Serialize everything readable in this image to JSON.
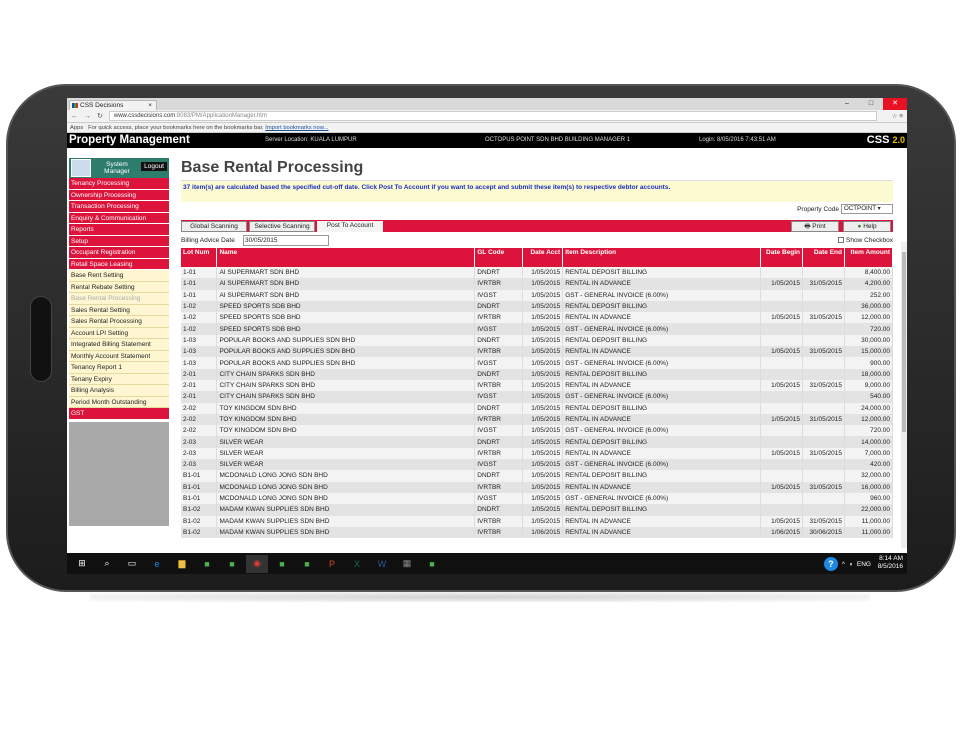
{
  "browser": {
    "tab_title": "CSS Decisions",
    "url_host": "www.cssdecisions.com",
    "url_path": ":8083/PM/ApplicationManager.htm",
    "bookmarks_apps": "Apps",
    "bookmarks_text": "For quick access, place your bookmarks here on the bookmarks bar.",
    "bookmarks_link": "Import bookmarks now..."
  },
  "header": {
    "brand": "Property Management",
    "server": "Server Location: KUALA LUMPUR",
    "company": "OCTOPUS POINT SDN BHD  BUILDING MANAGER 1",
    "login": "Login: 8/05/2016 7:43:51 AM",
    "product": "CSS",
    "version": "2.0"
  },
  "sidebar": {
    "user_role": "System Manager",
    "logout": "Logout",
    "main_items": [
      "Tenancy Processing",
      "Ownership Processing",
      "Transaction Processing",
      "Enquiry & Communication",
      "Reports",
      "Setup",
      "Occupant Registration",
      "Retail Space Leasing"
    ],
    "sub_items": [
      "Base Rent Setting",
      "Rental Rebate Setting",
      "Base Rental Processing",
      "Sales Rental Setting",
      "Sales Rental Processing",
      "Account LPI Setting",
      "Integrated Billing Statement",
      "Monthly Account Statement",
      "Tenancy Report 1",
      "Tenany Expiry",
      "Billing Analysis",
      "Period Month Outstanding"
    ],
    "last_item": "GST"
  },
  "page": {
    "title": "Base Rental Processing",
    "message": "37 item(s) are calculated based the specified cut-off date. Click Post To Account if you want to accept and submit these item(s) to respective debtor accounts.",
    "property_code_label": "Property Code",
    "property_code_value": "OCTPOINT",
    "buttons": {
      "global": "Global Scanning",
      "selective": "Selective Scanning",
      "post": "Post To Account",
      "print": "Print",
      "help": "Help"
    },
    "billing_label": "Billing Advice Date",
    "billing_value": "30/05/2015",
    "show_checkbox": "Show Checkbox"
  },
  "table": {
    "columns": [
      "Lot Num",
      "Name",
      "GL Code",
      "Date Acct",
      "Item Description",
      "Date Begin",
      "Date End",
      "Item Amount"
    ],
    "rows": [
      [
        "1-01",
        "AI SUPERMART SDN BHD",
        "DNDRT",
        "1/05/2015",
        "RENTAL DEPOSIT BILLING",
        "",
        "",
        "8,400.00"
      ],
      [
        "1-01",
        "AI SUPERMART SDN BHD",
        "IVRTBR",
        "1/05/2015",
        "RENTAL IN ADVANCE",
        "1/05/2015",
        "31/05/2015",
        "4,200.00"
      ],
      [
        "1-01",
        "AI SUPERMART SDN BHD",
        "IVGST",
        "1/05/2015",
        "GST - GENERAL INVOICE (6.00%)",
        "",
        "",
        "252.00"
      ],
      [
        "1-02",
        "SPEED SPORTS SDB BHD",
        "DNDRT",
        "1/05/2015",
        "RENTAL DEPOSIT BILLING",
        "",
        "",
        "36,000.00"
      ],
      [
        "1-02",
        "SPEED SPORTS SDB BHD",
        "IVRTBR",
        "1/05/2015",
        "RENTAL IN ADVANCE",
        "1/05/2015",
        "31/05/2015",
        "12,000.00"
      ],
      [
        "1-02",
        "SPEED SPORTS SDB BHD",
        "IVGST",
        "1/05/2015",
        "GST - GENERAL INVOICE (6.00%)",
        "",
        "",
        "720.00"
      ],
      [
        "1-03",
        "POPULAR BOOKS AND SUPPLIES SDN BHD",
        "DNDRT",
        "1/05/2015",
        "RENTAL DEPOSIT BILLING",
        "",
        "",
        "30,000.00"
      ],
      [
        "1-03",
        "POPULAR BOOKS AND SUPPLIES SDN BHD",
        "IVRTBR",
        "1/05/2015",
        "RENTAL IN ADVANCE",
        "1/05/2015",
        "31/05/2015",
        "15,000.00"
      ],
      [
        "1-03",
        "POPULAR BOOKS AND SUPPLIES SDN BHD",
        "IVGST",
        "1/05/2015",
        "GST - GENERAL INVOICE (6.00%)",
        "",
        "",
        "900.00"
      ],
      [
        "2-01",
        "CITY CHAIN SPARKS SDN BHD",
        "DNDRT",
        "1/05/2015",
        "RENTAL DEPOSIT BILLING",
        "",
        "",
        "18,000.00"
      ],
      [
        "2-01",
        "CITY CHAIN SPARKS SDN BHD",
        "IVRTBR",
        "1/05/2015",
        "RENTAL IN ADVANCE",
        "1/05/2015",
        "31/05/2015",
        "9,000.00"
      ],
      [
        "2-01",
        "CITY CHAIN SPARKS SDN BHD",
        "IVGST",
        "1/05/2015",
        "GST - GENERAL INVOICE (6.00%)",
        "",
        "",
        "540.00"
      ],
      [
        "2-02",
        "TOY KINGDOM SDN BHD",
        "DNDRT",
        "1/05/2015",
        "RENTAL DEPOSIT BILLING",
        "",
        "",
        "24,000.00"
      ],
      [
        "2-02",
        "TOY KINGDOM SDN BHD",
        "IVRTBR",
        "1/05/2015",
        "RENTAL IN ADVANCE",
        "1/05/2015",
        "31/05/2015",
        "12,000.00"
      ],
      [
        "2-02",
        "TOY KINGDOM SDN BHD",
        "IVGST",
        "1/05/2015",
        "GST - GENERAL INVOICE (6.00%)",
        "",
        "",
        "720.00"
      ],
      [
        "2-03",
        "SILVER WEAR",
        "DNDRT",
        "1/05/2015",
        "RENTAL DEPOSIT BILLING",
        "",
        "",
        "14,000.00"
      ],
      [
        "2-03",
        "SILVER WEAR",
        "IVRTBR",
        "1/05/2015",
        "RENTAL IN ADVANCE",
        "1/05/2015",
        "31/05/2015",
        "7,000.00"
      ],
      [
        "2-03",
        "SILVER WEAR",
        "IVGST",
        "1/05/2015",
        "GST - GENERAL INVOICE (6.00%)",
        "",
        "",
        "420.00"
      ],
      [
        "B1-01",
        "MCDONALD LONG JONG SDN BHD",
        "DNDRT",
        "1/05/2015",
        "RENTAL DEPOSIT BILLING",
        "",
        "",
        "32,000.00"
      ],
      [
        "B1-01",
        "MCDONALD LONG JONG SDN BHD",
        "IVRTBR",
        "1/05/2015",
        "RENTAL IN ADVANCE",
        "1/05/2015",
        "31/05/2015",
        "16,000.00"
      ],
      [
        "B1-01",
        "MCDONALD LONG JONG SDN BHD",
        "IVGST",
        "1/05/2015",
        "GST - GENERAL INVOICE (6.00%)",
        "",
        "",
        "960.00"
      ],
      [
        "B1-02",
        "MADAM KWAN SUPPLIES SDN BHD",
        "DNDRT",
        "1/05/2015",
        "RENTAL DEPOSIT BILLING",
        "",
        "",
        "22,000.00"
      ],
      [
        "B1-02",
        "MADAM KWAN SUPPLIES SDN BHD",
        "IVRTBR",
        "1/05/2015",
        "RENTAL IN ADVANCE",
        "1/05/2015",
        "31/05/2015",
        "11,000.00"
      ],
      [
        "B1-02",
        "MADAM KWAN SUPPLIES SDN BHD",
        "IVRTBR",
        "1/06/2015",
        "RENTAL IN ADVANCE",
        "1/06/2015",
        "30/06/2015",
        "11,000.00"
      ]
    ]
  },
  "taskbar": {
    "lang": "ENG",
    "time": "8:14 AM",
    "date": "8/5/2016",
    "apps": [
      "start-icon",
      "search-icon",
      "task-view-icon",
      "edge-icon",
      "file-explorer-icon",
      "app-icon",
      "app-icon",
      "chrome-icon",
      "app-icon",
      "app-icon",
      "powerpoint-icon",
      "excel-icon",
      "word-icon",
      "calculator-icon",
      "app-icon"
    ]
  },
  "colors": {
    "accent": "#dc143c",
    "sidebar_sub_bg": "#fdf6d0",
    "header_bg": "#000000",
    "message_bg": "#fcfad0"
  }
}
